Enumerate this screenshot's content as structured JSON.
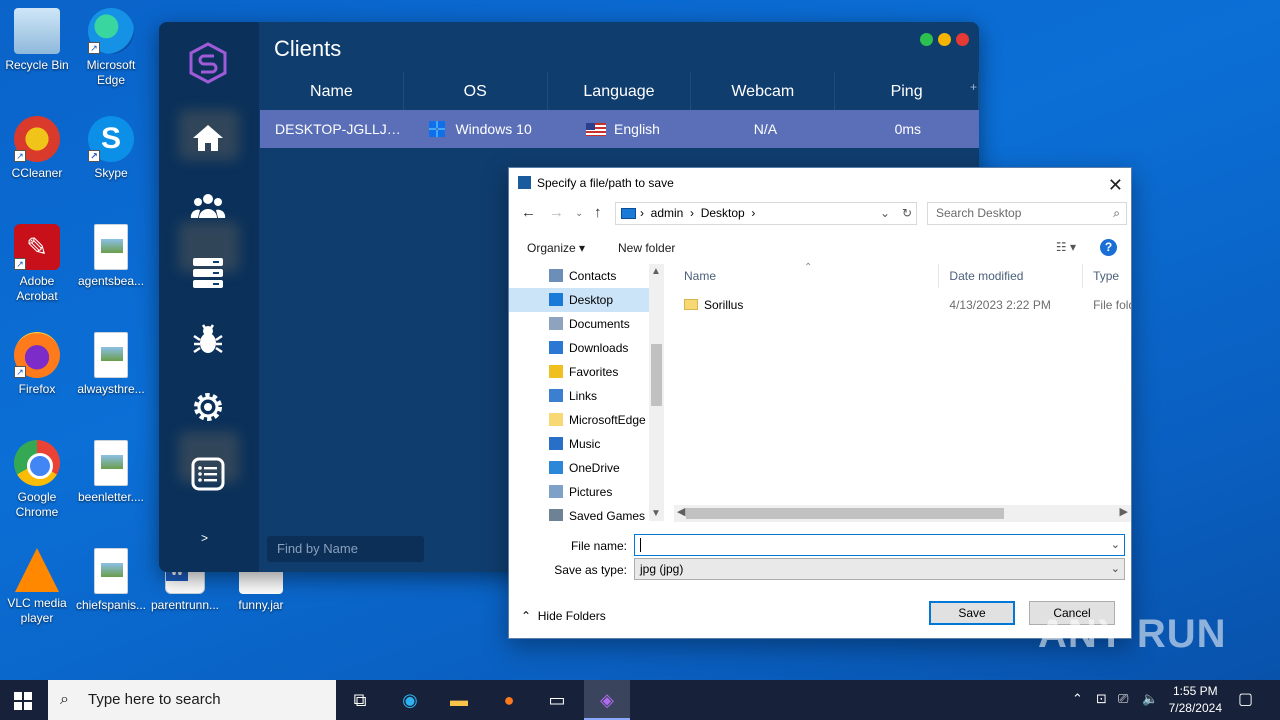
{
  "desktop": {
    "icons": [
      {
        "label": "Recycle Bin"
      },
      {
        "label": "Microsoft Edge"
      },
      {
        "label": "CCleaner"
      },
      {
        "label": "Skype"
      },
      {
        "label": "Adobe Acrobat"
      },
      {
        "label": "agentsbea..."
      },
      {
        "label": "Firefox"
      },
      {
        "label": "alwaysthre..."
      },
      {
        "label": "Google Chrome"
      },
      {
        "label": "beenletter...."
      },
      {
        "label": "VLC media player"
      },
      {
        "label": "chiefspanis..."
      },
      {
        "label": "parentrunn..."
      },
      {
        "label": "funny.jar"
      }
    ]
  },
  "app": {
    "title": "Clients",
    "columns": [
      "Name",
      "OS",
      "Language",
      "Webcam",
      "Ping"
    ],
    "add_column_icon": "+",
    "rows": [
      {
        "name": "DESKTOP-JGLLJL...",
        "os": "Windows 10",
        "language": "English",
        "webcam": "N/A",
        "ping": "0ms"
      }
    ],
    "find_placeholder": "Find by Name",
    "expand_label": ">",
    "window_dots": [
      "#2cc14f",
      "#f4b400",
      "#e53935"
    ],
    "sidebar_icons": [
      "home-icon",
      "users-icon",
      "server-icon",
      "bug-icon",
      "gear-icon",
      "list-icon"
    ]
  },
  "dialog": {
    "title": "Specify a file/path to save",
    "address": {
      "crumbs": [
        "admin",
        "Desktop"
      ]
    },
    "search_placeholder": "Search Desktop",
    "organize_label": "Organize",
    "new_folder_label": "New folder",
    "help_label": "?",
    "tree": [
      {
        "label": "Contacts",
        "icon": "contacts-icon",
        "selected": false
      },
      {
        "label": "Desktop",
        "icon": "desktop-icon",
        "selected": true
      },
      {
        "label": "Documents",
        "icon": "documents-icon",
        "selected": false
      },
      {
        "label": "Downloads",
        "icon": "downloads-icon",
        "selected": false
      },
      {
        "label": "Favorites",
        "icon": "favorites-icon",
        "selected": false
      },
      {
        "label": "Links",
        "icon": "links-icon",
        "selected": false
      },
      {
        "label": "MicrosoftEdge",
        "icon": "folder-icon",
        "selected": false
      },
      {
        "label": "Music",
        "icon": "music-icon",
        "selected": false
      },
      {
        "label": "OneDrive",
        "icon": "onedrive-icon",
        "selected": false
      },
      {
        "label": "Pictures",
        "icon": "pictures-icon",
        "selected": false
      },
      {
        "label": "Saved Games",
        "icon": "saved-games-icon",
        "selected": false
      }
    ],
    "columns": [
      "Name",
      "Date modified",
      "Type"
    ],
    "files": [
      {
        "name": "Sorillus",
        "date": "4/13/2023 2:22 PM",
        "type": "File fold"
      }
    ],
    "file_name_label": "File name:",
    "file_name_value": "",
    "save_type_label": "Save as type:",
    "save_type_value": "jpg (jpg)",
    "hide_folders_label": "Hide Folders",
    "save_label": "Save",
    "cancel_label": "Cancel"
  },
  "watermark": "ANY RUN",
  "taskbar": {
    "search_placeholder": "Type here to search",
    "time": "1:55 PM",
    "date": "7/28/2024"
  }
}
